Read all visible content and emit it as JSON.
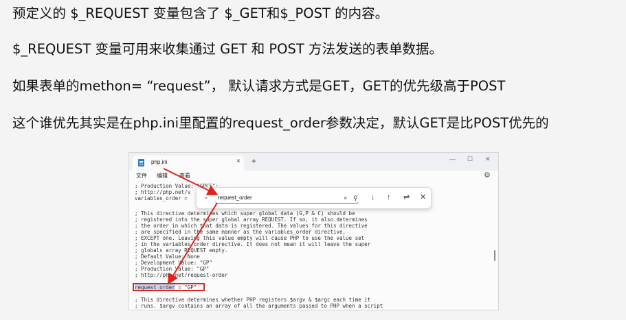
{
  "slide": {
    "lines": [
      "预定义的 $_REQUEST 变量包含了 $_GET和$_POST 的内容。",
      "$_REQUEST 变量可用来收集通过 GET 和 POST 方法发送的表单数据。",
      "如果表单的methon= “request”， 默认请求方式是GET，GET的优先级高于POST",
      "这个谁优先其实是在php.ini里配置的request_order参数决定，默认GET是比POST优先的"
    ]
  },
  "window": {
    "tab_title": "php.ini",
    "tab_close": "×",
    "new_tab": "+",
    "controls": {
      "minimize": "—",
      "maximize": "☐",
      "close": "✕"
    },
    "menu": {
      "file": "文件",
      "edit": "编辑",
      "view": "查看"
    },
    "settings_icon": "gear-icon",
    "settings_glyph": "⚙"
  },
  "find": {
    "value": "request_order",
    "chevron": "⌄",
    "clear": "×",
    "search": "⚲",
    "down": "↓",
    "up": "↑",
    "options": "⇌",
    "close": "✕"
  },
  "editor": {
    "lines": [
      "; Production Value: \"GPCS\";",
      "; http://php.net/v",
      "variables_order =",
      "",
      "; This directive determines which super global data (G,P & C) should be",
      "; registered into the super global array REQUEST. If so, it also determines",
      "; the order in which that data is registered. The values for this directive",
      "; are specified in the same manner as the variables_order directive,",
      "; EXCEPT one. Leaving this value empty will cause PHP to use the value set",
      "; in the variables_order directive. It does not mean it will leave the super",
      "; globals array REQUEST empty.",
      "; Default Value: None",
      "; Development Value: \"GP\"",
      "; Production Value: \"GP\"",
      "; http://php.net/request-order",
      "",
      "; This directive determines whether PHP registers $argv & $argc each time it",
      "; runs. $argv contains an array of all the arguments passed to PHP when a script"
    ],
    "setting_key": "request_order",
    "setting_rest": " = \"GP\""
  },
  "colors": {
    "annotation": "#e0231c",
    "highlight": "#bfd7f3",
    "accent": "#2f6fd1"
  }
}
